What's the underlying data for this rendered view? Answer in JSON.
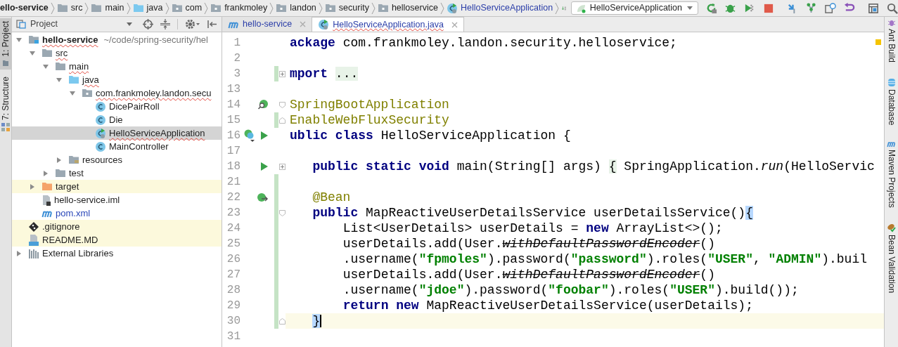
{
  "breadcrumbs": [
    {
      "label": "ello-service",
      "kind": "module"
    },
    {
      "label": "src",
      "kind": "folder"
    },
    {
      "label": "main",
      "kind": "folder"
    },
    {
      "label": "java",
      "kind": "source-folder"
    },
    {
      "label": "com",
      "kind": "package"
    },
    {
      "label": "frankmoley",
      "kind": "package"
    },
    {
      "label": "landon",
      "kind": "package"
    },
    {
      "label": "security",
      "kind": "package"
    },
    {
      "label": "helloservice",
      "kind": "package"
    },
    {
      "label": "HelloServiceApplication",
      "kind": "spring-class"
    }
  ],
  "run_config": {
    "label": "HelloServiceApplication"
  },
  "left_tools": [
    {
      "label": "1: Project",
      "kind": "folder",
      "selected": true
    },
    {
      "label": "7: Structure",
      "kind": "structure",
      "selected": false
    }
  ],
  "right_tools": [
    {
      "label": "Ant Build",
      "kind": "ant"
    },
    {
      "label": "Database",
      "kind": "database"
    },
    {
      "label": "Maven Projects",
      "kind": "maven"
    },
    {
      "label": "Bean Validation",
      "kind": "bean"
    }
  ],
  "project_panel": {
    "title": "Project",
    "tree": [
      {
        "label": "hello-service",
        "kind": "module",
        "bold": true,
        "error": true,
        "path": "~/code/spring-security/hel",
        "expanded": true,
        "selected": false,
        "highlighted": false,
        "children": [
          {
            "label": "src",
            "kind": "folder",
            "error": true,
            "expanded": true,
            "selected": false,
            "highlighted": false,
            "children": [
              {
                "label": "main",
                "kind": "folder",
                "error": true,
                "expanded": true,
                "selected": false,
                "highlighted": false,
                "children": [
                  {
                    "label": "java",
                    "kind": "source-folder",
                    "error": true,
                    "expanded": true,
                    "selected": false,
                    "highlighted": false,
                    "children": [
                      {
                        "label": "com.frankmoley.landon.secu",
                        "kind": "package",
                        "error": true,
                        "expanded": true,
                        "selected": false,
                        "highlighted": false,
                        "children": [
                          {
                            "label": "DicePairRoll",
                            "kind": "class",
                            "selected": false,
                            "highlighted": false
                          },
                          {
                            "label": "Die",
                            "kind": "class",
                            "selected": false,
                            "highlighted": false
                          },
                          {
                            "label": "HelloServiceApplication",
                            "kind": "spring-class",
                            "error": true,
                            "selected": true,
                            "highlighted": false
                          },
                          {
                            "label": "MainController",
                            "kind": "class",
                            "selected": false,
                            "highlighted": false
                          }
                        ]
                      }
                    ]
                  },
                  {
                    "label": "resources",
                    "kind": "resources",
                    "expanded": false,
                    "selected": false,
                    "highlighted": false
                  }
                ]
              },
              {
                "label": "test",
                "kind": "folder",
                "expanded": false,
                "selected": false,
                "highlighted": false
              }
            ]
          },
          {
            "label": "target",
            "kind": "excluded",
            "expanded": false,
            "selected": false,
            "highlighted": true
          },
          {
            "label": "hello-service.iml",
            "kind": "iml",
            "selected": false,
            "highlighted": false
          },
          {
            "label": "pom.xml",
            "kind": "maven",
            "modified": true,
            "selected": false,
            "highlighted": false
          }
        ]
      },
      {
        "label": ".gitignore",
        "kind": "git",
        "selected": false,
        "highlighted": true
      },
      {
        "label": "README.MD",
        "kind": "markdown",
        "selected": false,
        "highlighted": true
      },
      {
        "label": "External Libraries",
        "kind": "libraries",
        "expanded": false,
        "selected": false,
        "highlighted": false
      }
    ]
  },
  "tabs": [
    {
      "label": "hello-service",
      "kind": "maven",
      "selected": false,
      "error": false
    },
    {
      "label": "HelloServiceApplication.java",
      "kind": "spring-class",
      "selected": true,
      "error": true
    }
  ],
  "editor": {
    "lines": [
      {
        "number": "1",
        "tokens": [
          {
            "text": "ackage",
            "kind": "keyword"
          },
          {
            "text": " com.frankmoley.landon.security.helloservice;",
            "kind": "plain"
          }
        ]
      },
      {
        "number": "2"
      },
      {
        "number": "3",
        "fold": {
          "kind": "expand"
        },
        "changed": true,
        "tokens": [
          {
            "text": "mport",
            "kind": "keyword"
          },
          {
            "text": " ...",
            "kind": "folded"
          }
        ]
      },
      {
        "number": "13"
      },
      {
        "number": "14",
        "fold": {
          "kind": "open"
        },
        "gutter": [
          {
            "kind": "bean-search"
          }
        ],
        "tokens": [
          {
            "text": "SpringBootApplication",
            "kind": "annotation"
          }
        ]
      },
      {
        "number": "15",
        "fold": {
          "kind": "close"
        },
        "changed": true,
        "tokens": [
          {
            "text": "EnableWebFluxSecurity",
            "kind": "annotation"
          }
        ]
      },
      {
        "number": "16",
        "gutter": [
          {
            "kind": "bean-class"
          },
          {
            "kind": "run"
          }
        ],
        "tokens": [
          {
            "text": "ublic class",
            "kind": "keyword"
          },
          {
            "text": " HelloServiceApplication {",
            "kind": "plain"
          }
        ]
      },
      {
        "number": "17"
      },
      {
        "number": "18",
        "fold": {
          "kind": "expand"
        },
        "gutter": [
          {
            "kind": "run"
          }
        ],
        "tokens": [
          {
            "text": "   public static void",
            "kind": "keyword"
          },
          {
            "text": " main(String[] args) ",
            "kind": "plain"
          },
          {
            "text": "{",
            "kind": "folded"
          },
          {
            "text": " SpringApplication.",
            "kind": "plain"
          },
          {
            "text": "run",
            "kind": "italic"
          },
          {
            "text": "(HelloServic",
            "kind": "plain"
          }
        ]
      },
      {
        "number": "21",
        "changed": true
      },
      {
        "number": "22",
        "changed": true,
        "gutter": [
          {
            "kind": "bean-link"
          }
        ],
        "tokens": [
          {
            "text": "   @Bean",
            "kind": "annotation"
          }
        ]
      },
      {
        "number": "23",
        "fold": {
          "kind": "open"
        },
        "changed": true,
        "tokens": [
          {
            "text": "   public",
            "kind": "keyword"
          },
          {
            "text": " MapReactiveUserDetailsService userDetailsService()",
            "kind": "plain"
          },
          {
            "text": "{",
            "kind": "match"
          }
        ]
      },
      {
        "number": "24",
        "changed": true,
        "tokens": [
          {
            "text": "       List<UserDetails> userDetails = ",
            "kind": "plain"
          },
          {
            "text": "new",
            "kind": "keyword"
          },
          {
            "text": " ArrayList<>();",
            "kind": "plain"
          }
        ]
      },
      {
        "number": "25",
        "changed": true,
        "tokens": [
          {
            "text": "       userDetails.add(User.",
            "kind": "plain"
          },
          {
            "text": "withDefaultPasswordEncoder",
            "kind": "deprecated"
          },
          {
            "text": "()",
            "kind": "plain"
          }
        ]
      },
      {
        "number": "26",
        "changed": true,
        "tokens": [
          {
            "text": "       .username(",
            "kind": "plain"
          },
          {
            "text": "\"fpmoles\"",
            "kind": "string"
          },
          {
            "text": ").password(",
            "kind": "plain"
          },
          {
            "text": "\"password\"",
            "kind": "string"
          },
          {
            "text": ").roles(",
            "kind": "plain"
          },
          {
            "text": "\"USER\"",
            "kind": "string"
          },
          {
            "text": ", ",
            "kind": "plain"
          },
          {
            "text": "\"ADMIN\"",
            "kind": "string"
          },
          {
            "text": ").buil",
            "kind": "plain"
          }
        ]
      },
      {
        "number": "27",
        "changed": true,
        "tokens": [
          {
            "text": "       userDetails.add(User.",
            "kind": "plain"
          },
          {
            "text": "withDefaultPasswordEncoder",
            "kind": "deprecated"
          },
          {
            "text": "()",
            "kind": "plain"
          }
        ]
      },
      {
        "number": "28",
        "changed": true,
        "tokens": [
          {
            "text": "       .username(",
            "kind": "plain"
          },
          {
            "text": "\"jdoe\"",
            "kind": "string"
          },
          {
            "text": ").password(",
            "kind": "plain"
          },
          {
            "text": "\"foobar\"",
            "kind": "string"
          },
          {
            "text": ").roles(",
            "kind": "plain"
          },
          {
            "text": "\"USER\"",
            "kind": "string"
          },
          {
            "text": ").build());",
            "kind": "plain"
          }
        ]
      },
      {
        "number": "29",
        "changed": true,
        "tokens": [
          {
            "text": "       return new",
            "kind": "keyword"
          },
          {
            "text": " MapReactiveUserDetailsService(userDetails);",
            "kind": "plain"
          }
        ]
      },
      {
        "number": "30",
        "fold": {
          "kind": "close"
        },
        "changed": true,
        "current": true,
        "tokens": [
          {
            "text": "   }",
            "kind": "match"
          }
        ]
      },
      {
        "number": "31"
      }
    ]
  }
}
